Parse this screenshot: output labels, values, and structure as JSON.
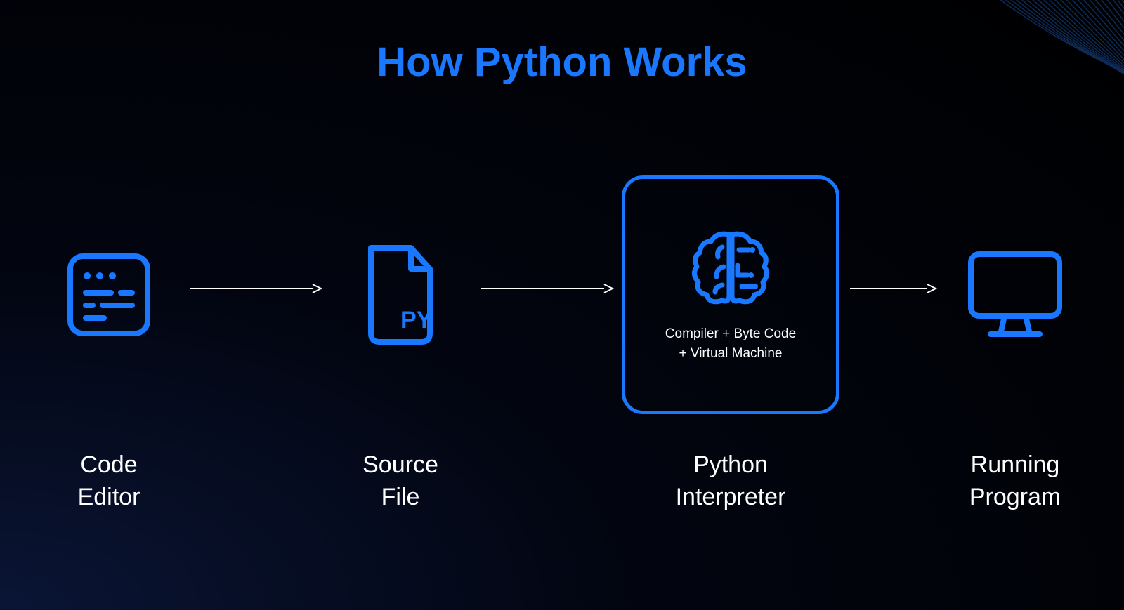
{
  "title": "How Python Works",
  "accent": "#1978FF",
  "text_color": "#ffffff",
  "steps": [
    {
      "id": "code-editor",
      "label": "Code\nEditor",
      "icon": "editor"
    },
    {
      "id": "source-file",
      "label": "Source\nFile",
      "icon": "file-py"
    },
    {
      "id": "python-interpreter",
      "label": "Python\nInterpreter",
      "icon": "brain",
      "sub": "Compiler + Byte Code\n+ Virtual Machine",
      "boxed": true
    },
    {
      "id": "running-program",
      "label": "Running\nProgram",
      "icon": "monitor"
    }
  ],
  "file_badge": "PY"
}
